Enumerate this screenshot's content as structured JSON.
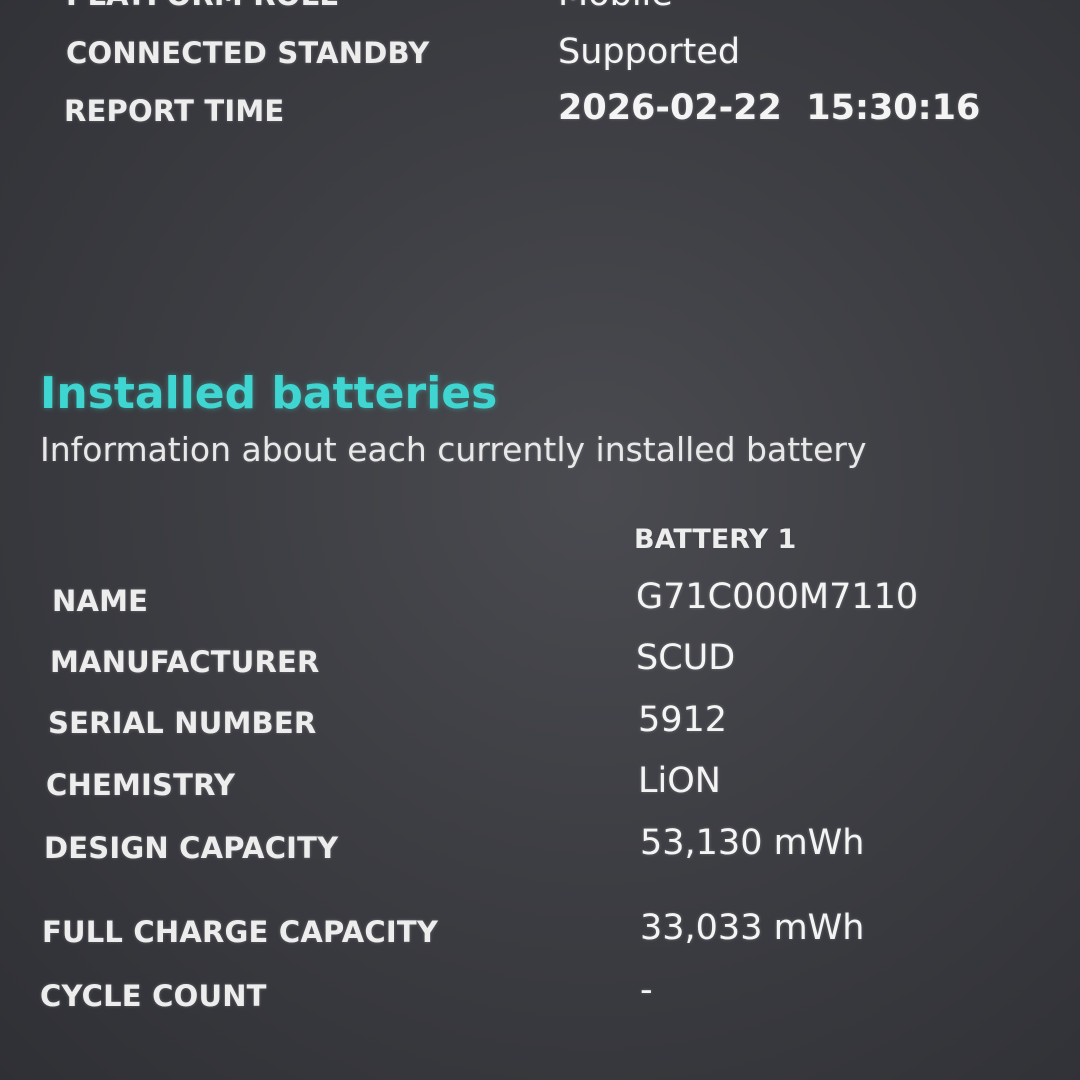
{
  "system_info": {
    "rows": [
      {
        "label": "PLATFORM ROLE",
        "value": "Mobile"
      },
      {
        "label": "CONNECTED STANDBY",
        "value": "Supported"
      },
      {
        "label": "REPORT TIME",
        "value": "2026-02-22  15:30:16"
      }
    ]
  },
  "installed_batteries": {
    "title": "Installed batteries",
    "subtitle": "Information about each currently installed battery",
    "column_header": "BATTERY 1",
    "rows": [
      {
        "label": "NAME",
        "value": "G71C000M7110"
      },
      {
        "label": "MANUFACTURER",
        "value": "SCUD"
      },
      {
        "label": "SERIAL NUMBER",
        "value": "5912"
      },
      {
        "label": "CHEMISTRY",
        "value": "LiON"
      },
      {
        "label": "DESIGN CAPACITY",
        "value": "53,130 mWh"
      },
      {
        "label": "FULL CHARGE CAPACITY",
        "value": "33,033 mWh"
      },
      {
        "label": "CYCLE COUNT",
        "value": "-"
      }
    ]
  },
  "colors": {
    "accent": "#3fd6d1",
    "background": "#3d3e43",
    "text": "#f2f2f2"
  }
}
